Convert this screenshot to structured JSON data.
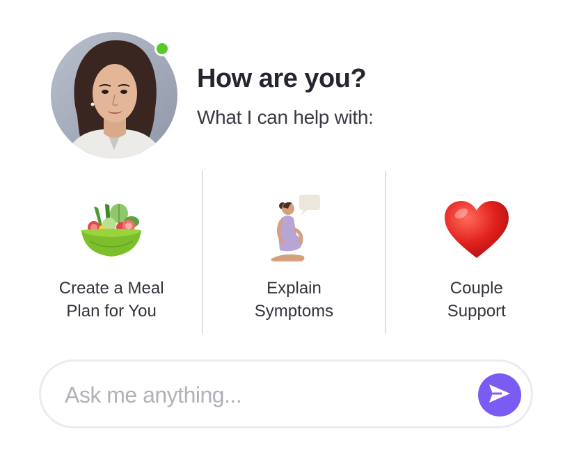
{
  "header": {
    "title": "How are you?",
    "subtitle": "What I can help with:",
    "avatar_icon": "assistant-avatar-photo",
    "online_color": "#5ac92a"
  },
  "cards": [
    {
      "label": "Create a Meal\nPlan for You",
      "icon": "salad-bowl-icon"
    },
    {
      "label": "Explain\nSymptoms",
      "icon": "pregnant-woman-icon"
    },
    {
      "label": "Couple\nSupport",
      "icon": "heart-icon"
    }
  ],
  "chat_input": {
    "placeholder": "Ask me anything...",
    "value": "",
    "send_icon": "send-icon",
    "accent": "#7b5cf3"
  }
}
